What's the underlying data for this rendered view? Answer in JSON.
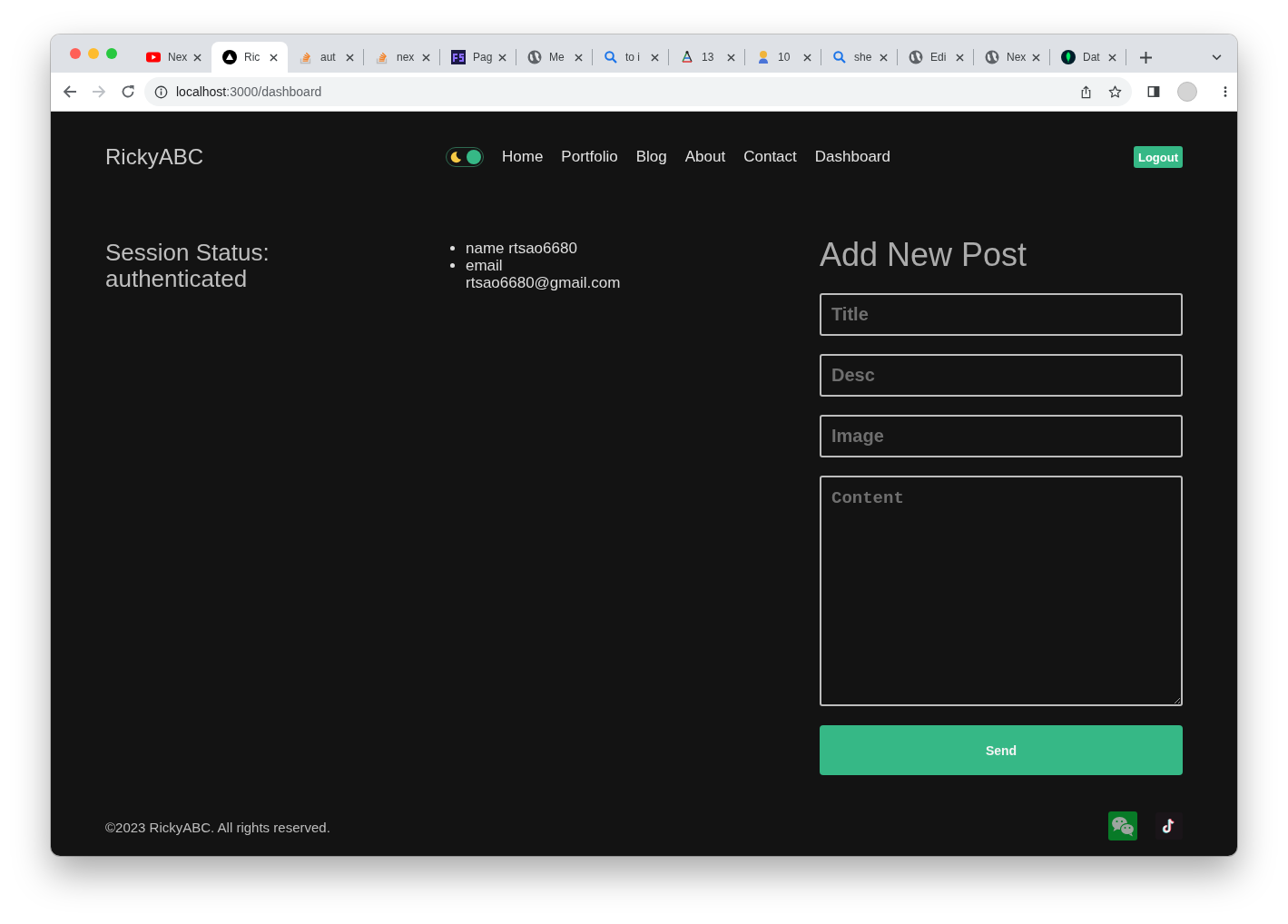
{
  "browser": {
    "tabs": [
      {
        "kind": "video",
        "title": "Nex",
        "selected": false
      },
      {
        "kind": "triangle",
        "title": "Ric",
        "selected": true
      },
      {
        "kind": "stack",
        "title": "aut",
        "selected": false
      },
      {
        "kind": "stack",
        "title": "nex",
        "selected": false
      },
      {
        "kind": "square",
        "title": "Pag",
        "selected": false
      },
      {
        "kind": "globe",
        "title": "Me",
        "selected": false
      },
      {
        "kind": "search",
        "title": "to i",
        "selected": false
      },
      {
        "kind": "figure",
        "title": "13",
        "selected": false
      },
      {
        "kind": "person",
        "title": "10",
        "selected": false
      },
      {
        "kind": "search",
        "title": "she",
        "selected": false
      },
      {
        "kind": "globe",
        "title": "Edi",
        "selected": false
      },
      {
        "kind": "globe",
        "title": "Nex",
        "selected": false
      },
      {
        "kind": "leaf",
        "title": "Dat",
        "selected": false
      }
    ],
    "toolbar": {
      "nav_buttons": [
        {
          "kind": "back",
          "disabled": false
        },
        {
          "kind": "forward",
          "disabled": true
        },
        {
          "kind": "reload",
          "disabled": false
        }
      ],
      "url_host": "localhost",
      "url_path": ":3000/dashboard"
    }
  },
  "site": {
    "logo": "RickyABC",
    "theme_toggle": {
      "on": true
    },
    "nav": [
      "Home",
      "Portfolio",
      "Blog",
      "About",
      "Contact",
      "Dashboard"
    ],
    "logout": "Logout"
  },
  "session": {
    "status": "Session Status: authenticated",
    "details": [
      "name rtsao6680",
      "email rtsao6680@gmail.com"
    ]
  },
  "post_form": {
    "heading": "Add New Post",
    "fields": [
      {
        "kind": "input",
        "placeholder": "Title"
      },
      {
        "kind": "input",
        "placeholder": "Desc"
      },
      {
        "kind": "input",
        "placeholder": "Image"
      },
      {
        "kind": "textarea",
        "placeholder": "Content"
      }
    ],
    "submit": "Send"
  },
  "footer": {
    "copyright": "©2023 RickyABC. All rights reserved.",
    "social": [
      {
        "kind": "chat"
      },
      {
        "kind": "note"
      }
    ]
  }
}
